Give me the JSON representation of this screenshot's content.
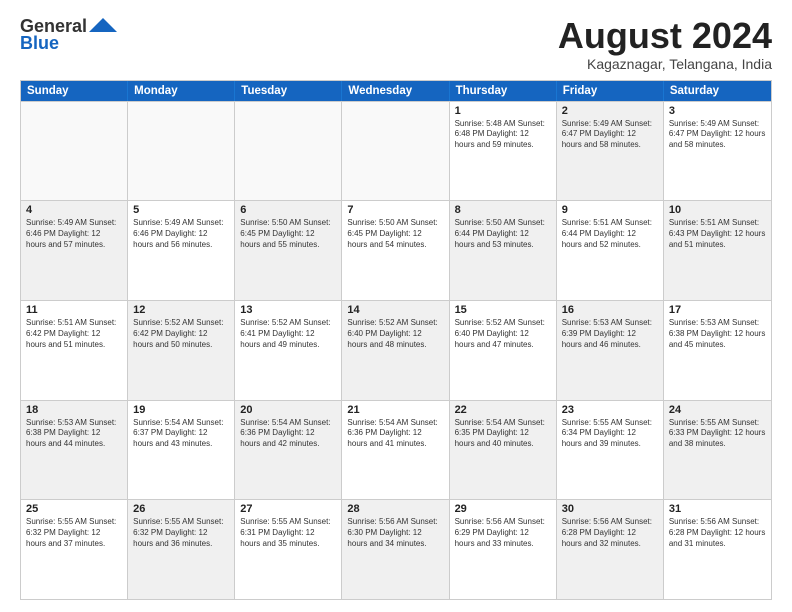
{
  "header": {
    "logo_line1": "General",
    "logo_line2": "Blue",
    "main_title": "August 2024",
    "subtitle": "Kagaznagar, Telangana, India"
  },
  "days_of_week": [
    "Sunday",
    "Monday",
    "Tuesday",
    "Wednesday",
    "Thursday",
    "Friday",
    "Saturday"
  ],
  "weeks": [
    [
      {
        "day": "",
        "info": "",
        "shaded": false,
        "empty": true
      },
      {
        "day": "",
        "info": "",
        "shaded": false,
        "empty": true
      },
      {
        "day": "",
        "info": "",
        "shaded": false,
        "empty": true
      },
      {
        "day": "",
        "info": "",
        "shaded": false,
        "empty": true
      },
      {
        "day": "1",
        "info": "Sunrise: 5:48 AM\nSunset: 6:48 PM\nDaylight: 12 hours\nand 59 minutes.",
        "shaded": false,
        "empty": false
      },
      {
        "day": "2",
        "info": "Sunrise: 5:49 AM\nSunset: 6:47 PM\nDaylight: 12 hours\nand 58 minutes.",
        "shaded": true,
        "empty": false
      },
      {
        "day": "3",
        "info": "Sunrise: 5:49 AM\nSunset: 6:47 PM\nDaylight: 12 hours\nand 58 minutes.",
        "shaded": false,
        "empty": false
      }
    ],
    [
      {
        "day": "4",
        "info": "Sunrise: 5:49 AM\nSunset: 6:46 PM\nDaylight: 12 hours\nand 57 minutes.",
        "shaded": true,
        "empty": false
      },
      {
        "day": "5",
        "info": "Sunrise: 5:49 AM\nSunset: 6:46 PM\nDaylight: 12 hours\nand 56 minutes.",
        "shaded": false,
        "empty": false
      },
      {
        "day": "6",
        "info": "Sunrise: 5:50 AM\nSunset: 6:45 PM\nDaylight: 12 hours\nand 55 minutes.",
        "shaded": true,
        "empty": false
      },
      {
        "day": "7",
        "info": "Sunrise: 5:50 AM\nSunset: 6:45 PM\nDaylight: 12 hours\nand 54 minutes.",
        "shaded": false,
        "empty": false
      },
      {
        "day": "8",
        "info": "Sunrise: 5:50 AM\nSunset: 6:44 PM\nDaylight: 12 hours\nand 53 minutes.",
        "shaded": true,
        "empty": false
      },
      {
        "day": "9",
        "info": "Sunrise: 5:51 AM\nSunset: 6:44 PM\nDaylight: 12 hours\nand 52 minutes.",
        "shaded": false,
        "empty": false
      },
      {
        "day": "10",
        "info": "Sunrise: 5:51 AM\nSunset: 6:43 PM\nDaylight: 12 hours\nand 51 minutes.",
        "shaded": true,
        "empty": false
      }
    ],
    [
      {
        "day": "11",
        "info": "Sunrise: 5:51 AM\nSunset: 6:42 PM\nDaylight: 12 hours\nand 51 minutes.",
        "shaded": false,
        "empty": false
      },
      {
        "day": "12",
        "info": "Sunrise: 5:52 AM\nSunset: 6:42 PM\nDaylight: 12 hours\nand 50 minutes.",
        "shaded": true,
        "empty": false
      },
      {
        "day": "13",
        "info": "Sunrise: 5:52 AM\nSunset: 6:41 PM\nDaylight: 12 hours\nand 49 minutes.",
        "shaded": false,
        "empty": false
      },
      {
        "day": "14",
        "info": "Sunrise: 5:52 AM\nSunset: 6:40 PM\nDaylight: 12 hours\nand 48 minutes.",
        "shaded": true,
        "empty": false
      },
      {
        "day": "15",
        "info": "Sunrise: 5:52 AM\nSunset: 6:40 PM\nDaylight: 12 hours\nand 47 minutes.",
        "shaded": false,
        "empty": false
      },
      {
        "day": "16",
        "info": "Sunrise: 5:53 AM\nSunset: 6:39 PM\nDaylight: 12 hours\nand 46 minutes.",
        "shaded": true,
        "empty": false
      },
      {
        "day": "17",
        "info": "Sunrise: 5:53 AM\nSunset: 6:38 PM\nDaylight: 12 hours\nand 45 minutes.",
        "shaded": false,
        "empty": false
      }
    ],
    [
      {
        "day": "18",
        "info": "Sunrise: 5:53 AM\nSunset: 6:38 PM\nDaylight: 12 hours\nand 44 minutes.",
        "shaded": true,
        "empty": false
      },
      {
        "day": "19",
        "info": "Sunrise: 5:54 AM\nSunset: 6:37 PM\nDaylight: 12 hours\nand 43 minutes.",
        "shaded": false,
        "empty": false
      },
      {
        "day": "20",
        "info": "Sunrise: 5:54 AM\nSunset: 6:36 PM\nDaylight: 12 hours\nand 42 minutes.",
        "shaded": true,
        "empty": false
      },
      {
        "day": "21",
        "info": "Sunrise: 5:54 AM\nSunset: 6:36 PM\nDaylight: 12 hours\nand 41 minutes.",
        "shaded": false,
        "empty": false
      },
      {
        "day": "22",
        "info": "Sunrise: 5:54 AM\nSunset: 6:35 PM\nDaylight: 12 hours\nand 40 minutes.",
        "shaded": true,
        "empty": false
      },
      {
        "day": "23",
        "info": "Sunrise: 5:55 AM\nSunset: 6:34 PM\nDaylight: 12 hours\nand 39 minutes.",
        "shaded": false,
        "empty": false
      },
      {
        "day": "24",
        "info": "Sunrise: 5:55 AM\nSunset: 6:33 PM\nDaylight: 12 hours\nand 38 minutes.",
        "shaded": true,
        "empty": false
      }
    ],
    [
      {
        "day": "25",
        "info": "Sunrise: 5:55 AM\nSunset: 6:32 PM\nDaylight: 12 hours\nand 37 minutes.",
        "shaded": false,
        "empty": false
      },
      {
        "day": "26",
        "info": "Sunrise: 5:55 AM\nSunset: 6:32 PM\nDaylight: 12 hours\nand 36 minutes.",
        "shaded": true,
        "empty": false
      },
      {
        "day": "27",
        "info": "Sunrise: 5:55 AM\nSunset: 6:31 PM\nDaylight: 12 hours\nand 35 minutes.",
        "shaded": false,
        "empty": false
      },
      {
        "day": "28",
        "info": "Sunrise: 5:56 AM\nSunset: 6:30 PM\nDaylight: 12 hours\nand 34 minutes.",
        "shaded": true,
        "empty": false
      },
      {
        "day": "29",
        "info": "Sunrise: 5:56 AM\nSunset: 6:29 PM\nDaylight: 12 hours\nand 33 minutes.",
        "shaded": false,
        "empty": false
      },
      {
        "day": "30",
        "info": "Sunrise: 5:56 AM\nSunset: 6:28 PM\nDaylight: 12 hours\nand 32 minutes.",
        "shaded": true,
        "empty": false
      },
      {
        "day": "31",
        "info": "Sunrise: 5:56 AM\nSunset: 6:28 PM\nDaylight: 12 hours\nand 31 minutes.",
        "shaded": false,
        "empty": false
      }
    ]
  ]
}
